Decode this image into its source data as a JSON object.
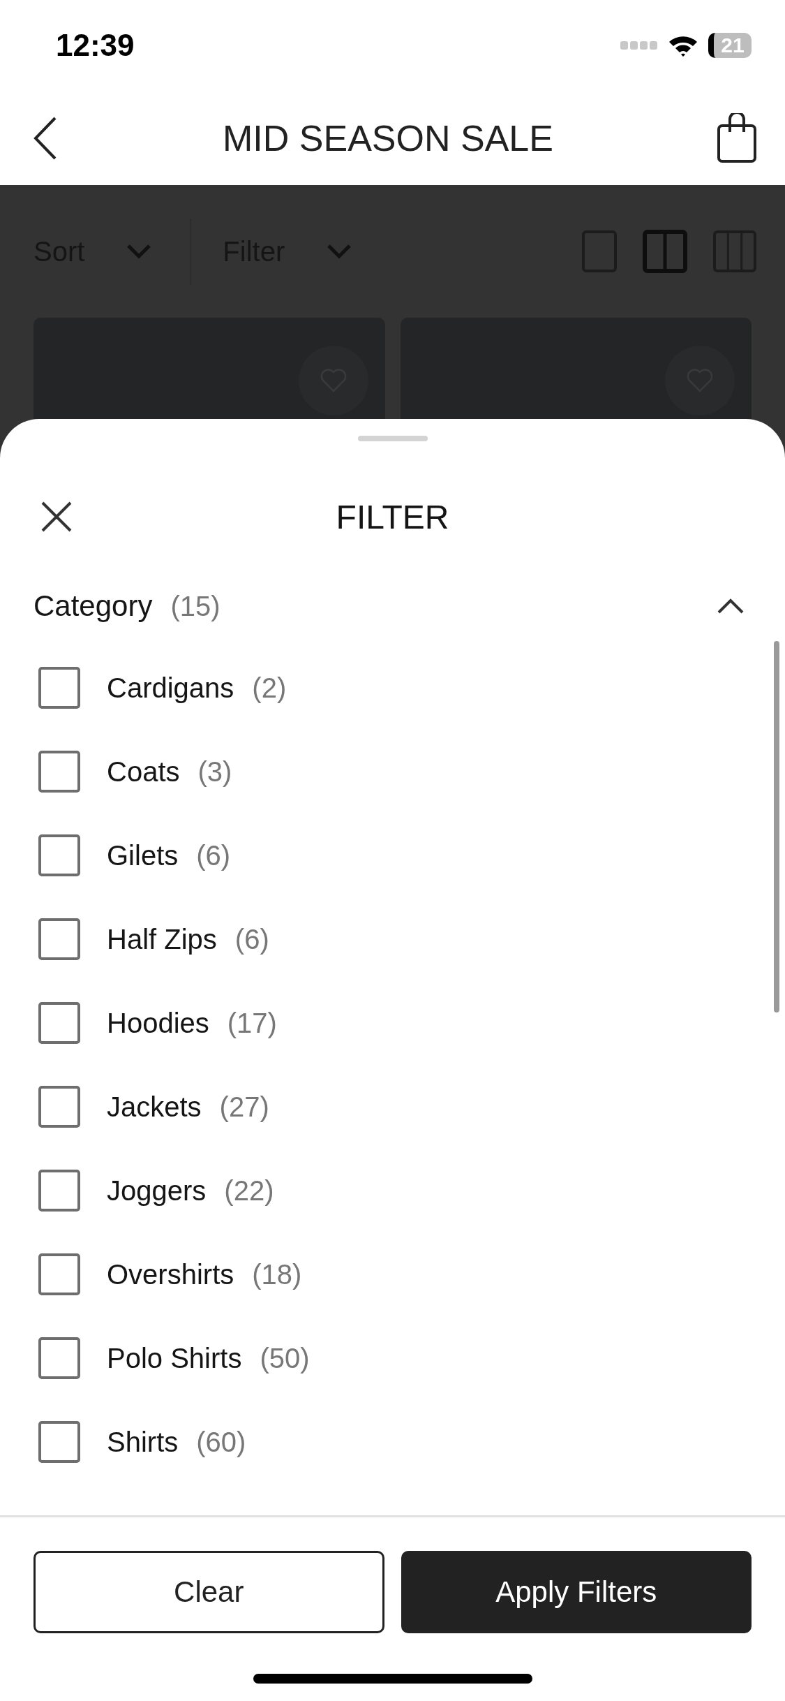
{
  "status_bar": {
    "time": "12:39",
    "battery": "21"
  },
  "nav": {
    "title": "MID SEASON SALE"
  },
  "toolbar": {
    "sort": "Sort",
    "filter": "Filter",
    "view_options": [
      {
        "kind": "single",
        "selected": false
      },
      {
        "kind": "double",
        "selected": true
      },
      {
        "kind": "triple",
        "selected": false
      }
    ]
  },
  "products": [
    {
      "kind": "card"
    },
    {
      "kind": "card"
    }
  ],
  "sheet": {
    "title": "FILTER",
    "section": {
      "label": "Category",
      "count": "(15)",
      "expanded": true
    },
    "options": [
      {
        "label": "Cardigans",
        "count": "(2)",
        "checked": false
      },
      {
        "label": "Coats",
        "count": "(3)",
        "checked": false
      },
      {
        "label": "Gilets",
        "count": "(6)",
        "checked": false
      },
      {
        "label": "Half Zips",
        "count": "(6)",
        "checked": false
      },
      {
        "label": "Hoodies",
        "count": "(17)",
        "checked": false
      },
      {
        "label": "Jackets",
        "count": "(27)",
        "checked": false
      },
      {
        "label": "Joggers",
        "count": "(22)",
        "checked": false
      },
      {
        "label": "Overshirts",
        "count": "(18)",
        "checked": false
      },
      {
        "label": "Polo Shirts",
        "count": "(50)",
        "checked": false
      },
      {
        "label": "Shirts",
        "count": "(60)",
        "checked": false
      }
    ],
    "buttons": {
      "clear": "Clear",
      "apply": "Apply Filters"
    }
  }
}
